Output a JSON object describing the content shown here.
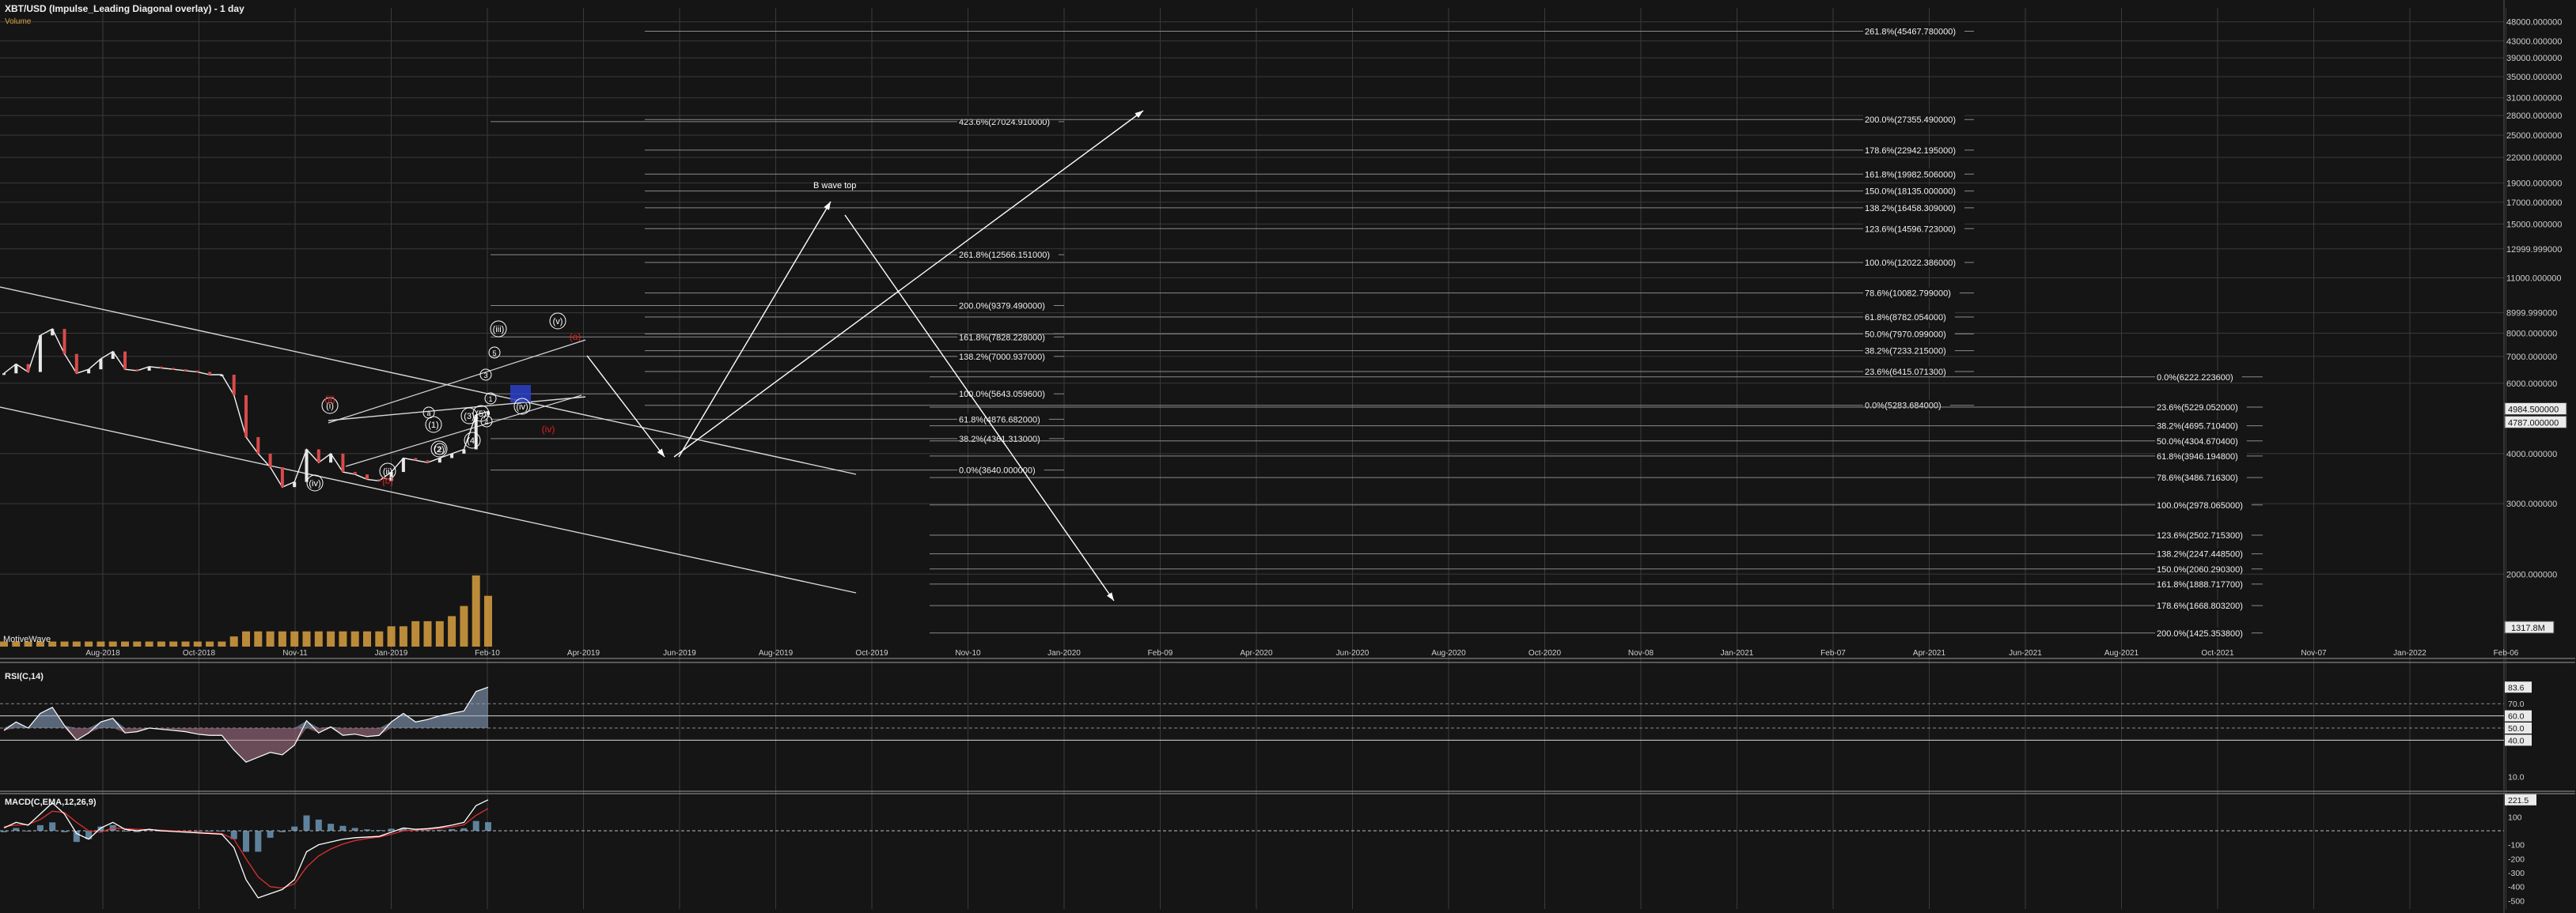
{
  "header": {
    "title": "XBT/USD (Impulse_Leading Diagonal overlay) - 1 day",
    "volume_label": "Volume",
    "indicator_label": "MotiveWave"
  },
  "colors": {
    "background": "#151515",
    "grid": "#3a3a3a",
    "axis_text": "#cfcfcf",
    "price_line": "#f2f2f2",
    "bear_candle": "#d94a4a",
    "bull_candle": "#e8e8e8",
    "fib_line": "#8a8a8a",
    "wave_white": "#ffffff",
    "wave_red": "#e02020",
    "projection_box": "#2c3fc8",
    "rsi_fill_up": "#8fa9c8",
    "rsi_fill_down": "#b07a90",
    "macd_line": "#ffffff",
    "macd_signal": "#e03030",
    "macd_hist": "#7fb0d6",
    "volume_bar": "#d9a040"
  },
  "chart_data": [
    {
      "type": "line",
      "name": "price",
      "title": "XBT/USD (Impulse_Leading Diagonal overlay) - 1 day",
      "yscale": "log",
      "ylim": [
        1317.8,
        52000
      ],
      "x_tick_labels": [
        "Aug-2018",
        "Oct-2018",
        "Nov-11",
        "Jan-2019",
        "Feb-10",
        "Apr-2019",
        "Jun-2019",
        "Aug-2019",
        "Oct-2019",
        "Nov-10",
        "Jan-2020",
        "Feb-09",
        "Apr-2020",
        "Jun-2020",
        "Aug-2020",
        "Oct-2020",
        "Nov-08",
        "Jan-2021",
        "Feb-07",
        "Apr-2021",
        "Jun-2021",
        "Aug-2021",
        "Oct-2021",
        "Nov-07",
        "Jan-2022",
        "Feb-06",
        "Apr-2022",
        "Jun-2022",
        "Aug-2022"
      ],
      "y_tick_labels": [
        "48000.000000",
        "43000.000000",
        "39000.000000",
        "35000.000000",
        "31000.000000",
        "28000.000000",
        "25000.000000",
        "22000.000000",
        "19000.000000",
        "17000.000000",
        "15000.000000",
        "12999.999000",
        "11000.000000",
        "8999.999000",
        "8000.000000",
        "7000.000000",
        "6000.000000",
        "4000.000000",
        "3000.000000",
        "2000.000000"
      ],
      "current_price_tag": "4984.500000",
      "secondary_price_tag": "4787.000000",
      "axis_bottom_tag": "1317.8M",
      "x": [
        "2018-07-01",
        "2018-07-08",
        "2018-07-15",
        "2018-07-22",
        "2018-07-29",
        "2018-08-05",
        "2018-08-12",
        "2018-08-19",
        "2018-08-26",
        "2018-09-02",
        "2018-09-09",
        "2018-09-16",
        "2018-09-23",
        "2018-09-30",
        "2018-10-07",
        "2018-10-14",
        "2018-10-21",
        "2018-10-28",
        "2018-11-04",
        "2018-11-11",
        "2018-11-18",
        "2018-11-25",
        "2018-12-02",
        "2018-12-09",
        "2018-12-16",
        "2018-12-23",
        "2018-12-30",
        "2019-01-06",
        "2019-01-13",
        "2019-01-20",
        "2019-01-27",
        "2019-02-03",
        "2019-02-10",
        "2019-02-17",
        "2019-02-24",
        "2019-03-03",
        "2019-03-10",
        "2019-03-17",
        "2019-03-24",
        "2019-03-31",
        "2019-04-07"
      ],
      "values": [
        6350,
        6700,
        6400,
        7900,
        8200,
        7100,
        6350,
        6500,
        6900,
        7200,
        6500,
        6450,
        6600,
        6550,
        6500,
        6450,
        6400,
        6300,
        6300,
        5600,
        4400,
        4000,
        3700,
        3300,
        3400,
        4100,
        3800,
        4000,
        3600,
        3550,
        3450,
        3420,
        3600,
        3900,
        3850,
        3800,
        3900,
        4000,
        4100,
        5000,
        5100
      ]
    },
    {
      "type": "bar",
      "name": "volume",
      "note_label": "Volume",
      "values": [
        1,
        1,
        1,
        1,
        1,
        1,
        1,
        1,
        1,
        1,
        1,
        1,
        1,
        1,
        1,
        1,
        1,
        1,
        1,
        2,
        3,
        3,
        3,
        3,
        3,
        3,
        3,
        3,
        3,
        3,
        3,
        3,
        4,
        4,
        5,
        5,
        5,
        6,
        8,
        14,
        10
      ]
    },
    {
      "type": "line",
      "name": "RSI(C,14)",
      "title": "RSI(C,14)",
      "ylim": [
        0,
        100
      ],
      "y_tick_labels": [
        "83.6",
        "70.0",
        "60.0",
        "50.0",
        "40.0",
        "10.0"
      ],
      "levels": [
        70,
        60,
        50,
        40
      ],
      "values": [
        48,
        55,
        50,
        62,
        67,
        52,
        40,
        46,
        55,
        58,
        46,
        47,
        50,
        49,
        48,
        47,
        45,
        44,
        44,
        32,
        22,
        26,
        30,
        28,
        36,
        56,
        46,
        51,
        44,
        45,
        43,
        44,
        55,
        62,
        55,
        57,
        60,
        62,
        64,
        80,
        83.6
      ]
    },
    {
      "type": "line",
      "name": "MACD(C,EMA,12,26,9)",
      "title": "MACD(C,EMA,12,26,9)",
      "y_tick_labels": [
        "221.5",
        "100",
        "-100",
        "-200",
        "-300",
        "-400",
        "-500"
      ],
      "macd": [
        20,
        60,
        40,
        120,
        200,
        120,
        -20,
        -60,
        20,
        60,
        10,
        0,
        10,
        0,
        -5,
        -10,
        -15,
        -20,
        -25,
        -120,
        -350,
        -480,
        -450,
        -420,
        -350,
        -150,
        -100,
        -80,
        -60,
        -50,
        -45,
        -40,
        -10,
        20,
        10,
        15,
        25,
        40,
        60,
        180,
        221.5
      ],
      "signal": [
        30,
        40,
        45,
        80,
        140,
        130,
        60,
        0,
        -10,
        20,
        15,
        10,
        8,
        5,
        0,
        -5,
        -10,
        -15,
        -20,
        -60,
        -200,
        -330,
        -400,
        -410,
        -380,
        -260,
        -180,
        -130,
        -95,
        -70,
        -55,
        -45,
        -25,
        0,
        5,
        10,
        18,
        28,
        42,
        110,
        160
      ]
    }
  ],
  "fib_labels": {
    "col_a": [
      "423.6%(27024.910000)",
      "261.8%(12566.151000)",
      "200.0%(9379.490000)",
      "161.8%(7828.228000)",
      "138.2%(7000.937000)",
      "100.0%(5643.059600)",
      "61.8%(4876.682000)",
      "38.2%(4361.313000)",
      "0.0%(3640.000000)"
    ],
    "col_b": [
      "261.8%(45467.780000)",
      "200.0%(27355.490000)",
      "178.6%(22942.195000)",
      "161.8%(19982.506000)",
      "150.0%(18135.000000)",
      "138.2%(16458.309000)",
      "123.6%(14596.723000)",
      "100.0%(12022.386000)",
      "78.6%(10082.799000)",
      "61.8%(8782.054000)",
      "50.0%(7970.099000)",
      "38.2%(7233.215000)",
      "23.6%(6415.071300)",
      "0.0%(5283.684000)"
    ],
    "col_c": [
      "0.0%(6222.223600)",
      "23.6%(5229.052000)",
      "38.2%(4695.710400)",
      "50.0%(4304.670400)",
      "61.8%(3946.194800)",
      "78.6%(3486.716300)",
      "100.0%(2978.065000)",
      "123.6%(2502.715300)",
      "138.2%(2247.448500)",
      "150.0%(2060.290300)",
      "161.8%(1888.717700)",
      "178.6%(1668.803200)",
      "200.0%(1425.353800)"
    ]
  },
  "annotations": {
    "b_wave_top": "B wave top",
    "wave_labels_white": [
      "(i)",
      "(ii)",
      "(iii)",
      "(iv)",
      "(v)",
      "(iv)",
      "1",
      "2",
      "3",
      "4",
      "5",
      "a",
      "(1)",
      "(2)",
      "(3)",
      "(4)",
      "(5)"
    ],
    "wave_labels_red": [
      "(ii)",
      "[b]",
      "(a)",
      "(iv)"
    ]
  }
}
